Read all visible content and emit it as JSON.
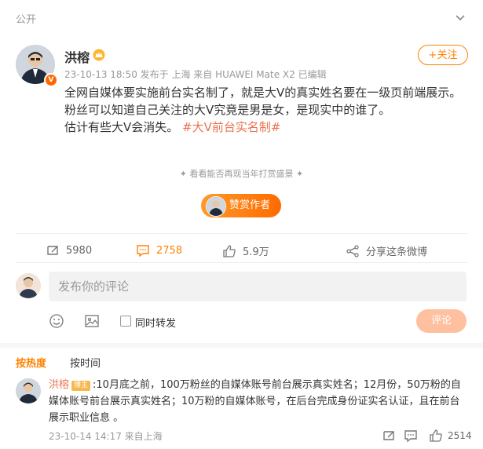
{
  "header": {
    "visibility": "公开",
    "menu_icon": "chevron-down-icon"
  },
  "post": {
    "author": "洪榕",
    "meta": "23-10-13 18:50 发布于 上海  来自 HUAWEI Mate X2 已编辑",
    "follow_label": "+关注",
    "lines": [
      "全网自媒体要实施前台实名制了，就是大V的真实姓名要在一级页前端展示。",
      "粉丝可以知道自己关注的大V究竟是男是女，是现实中的谁了。"
    ],
    "line3_text": "估计有些大V会消失。",
    "hashtag": "#大V前台实名制#"
  },
  "ticker": "看看能否再现当年打赏盛景",
  "tip_label": "赞赏作者",
  "actions": {
    "repost_count": "5980",
    "comment_count": "2758",
    "like_count": "5.9万",
    "share_label": "分享这条微博"
  },
  "compose": {
    "placeholder": "发布你的评论",
    "repost_checkbox_label": "同时转发",
    "submit_label": "评论"
  },
  "sort": {
    "hot": "按热度",
    "time": "按时间"
  },
  "comment": {
    "author": "洪榕",
    "badge": "博主",
    "text": ":10月底之前，100万粉丝的自媒体账号前台展示真实姓名；12月份，50万粉的自媒体账号前台展示真实姓名；10万粉的自媒体账号，在后台完成身份证实名认证，且在前台展示职业信息 。",
    "meta": "23-10-14 14:17 来自上海",
    "like_count": "2514"
  },
  "colors": {
    "accent": "#ff8200",
    "hashtag": "#eb7350",
    "muted": "#999999"
  }
}
